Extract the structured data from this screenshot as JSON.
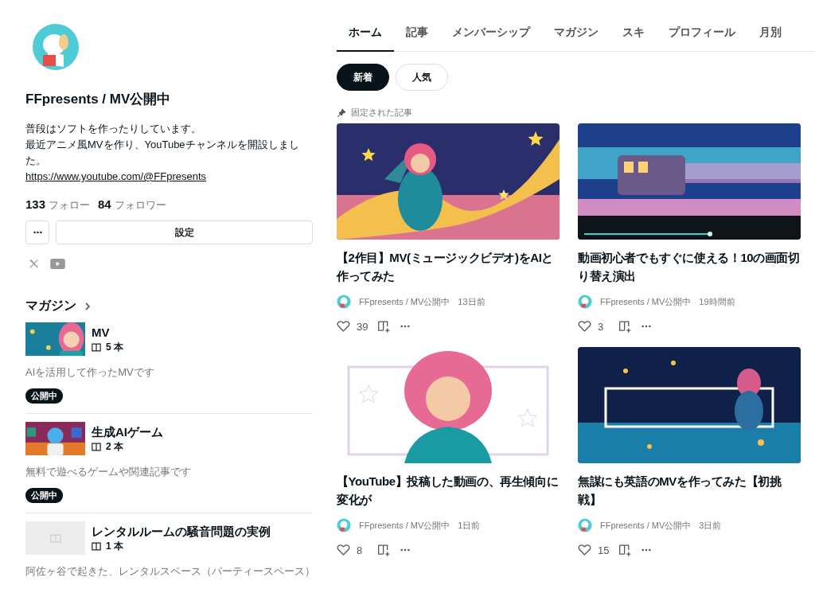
{
  "profile": {
    "name": "FFpresents / MV公開中",
    "bio": [
      "普段はソフトを作ったりしています。",
      "最近アニメ風MVを作り、YouTubeチャンネルを開設しました。"
    ],
    "link": "https://www.youtube.com/@FFpresents",
    "stats": [
      {
        "count": "133",
        "label": "フォロー"
      },
      {
        "count": "84",
        "label": "フォロワー"
      }
    ],
    "settings_button": "設定",
    "social": [
      {
        "kind": "x"
      },
      {
        "kind": "youtube"
      }
    ]
  },
  "magazines": {
    "heading": "マガジン",
    "items": [
      {
        "title": "MV",
        "count": "5 本",
        "description": "AIを活用して作ったMVです",
        "status": "公開中",
        "kind": "picture"
      },
      {
        "title": "生成AIゲーム",
        "count": "2 本",
        "description": "無料で遊べるゲームや関連記事です",
        "status": "公開中",
        "kind": "picture"
      },
      {
        "title": "レンタルルームの騒音問題の実例",
        "count": "1 本",
        "description": "阿佐ヶ谷で起きた、レンタルスペース（パーティースペース）",
        "kind": "placeholder"
      }
    ]
  },
  "tabs": [
    {
      "label": "ホーム",
      "selected": true
    },
    {
      "label": "記事",
      "selected": false
    },
    {
      "label": "メンバーシップ",
      "selected": false
    },
    {
      "label": "マガジン",
      "selected": false
    },
    {
      "label": "スキ",
      "selected": false
    },
    {
      "label": "プロフィール",
      "selected": false
    },
    {
      "label": "月別",
      "selected": false
    }
  ],
  "filters": [
    {
      "label": "新着",
      "selected": true
    },
    {
      "label": "人気",
      "selected": false
    }
  ],
  "pinned_label": "固定された記事",
  "articles": [
    {
      "title": "【2作目】MV(ミュージックビデオ)をAIと作ってみた",
      "author": "FFpresents / MV公開中",
      "time": "13日前",
      "likes": "39"
    },
    {
      "title": "動画初心者でもすぐに使える！10の画面切り替え演出",
      "author": "FFpresents / MV公開中",
      "time": "19時間前",
      "likes": "3"
    },
    {
      "title": "【YouTube】投稿した動画の、再生傾向に変化が",
      "author": "FFpresents / MV公開中",
      "time": "1日前",
      "likes": "8"
    },
    {
      "title": "無謀にも英語のMVを作ってみた【初挑戦】",
      "author": "FFpresents / MV公開中",
      "time": "3日前",
      "likes": "15"
    }
  ]
}
